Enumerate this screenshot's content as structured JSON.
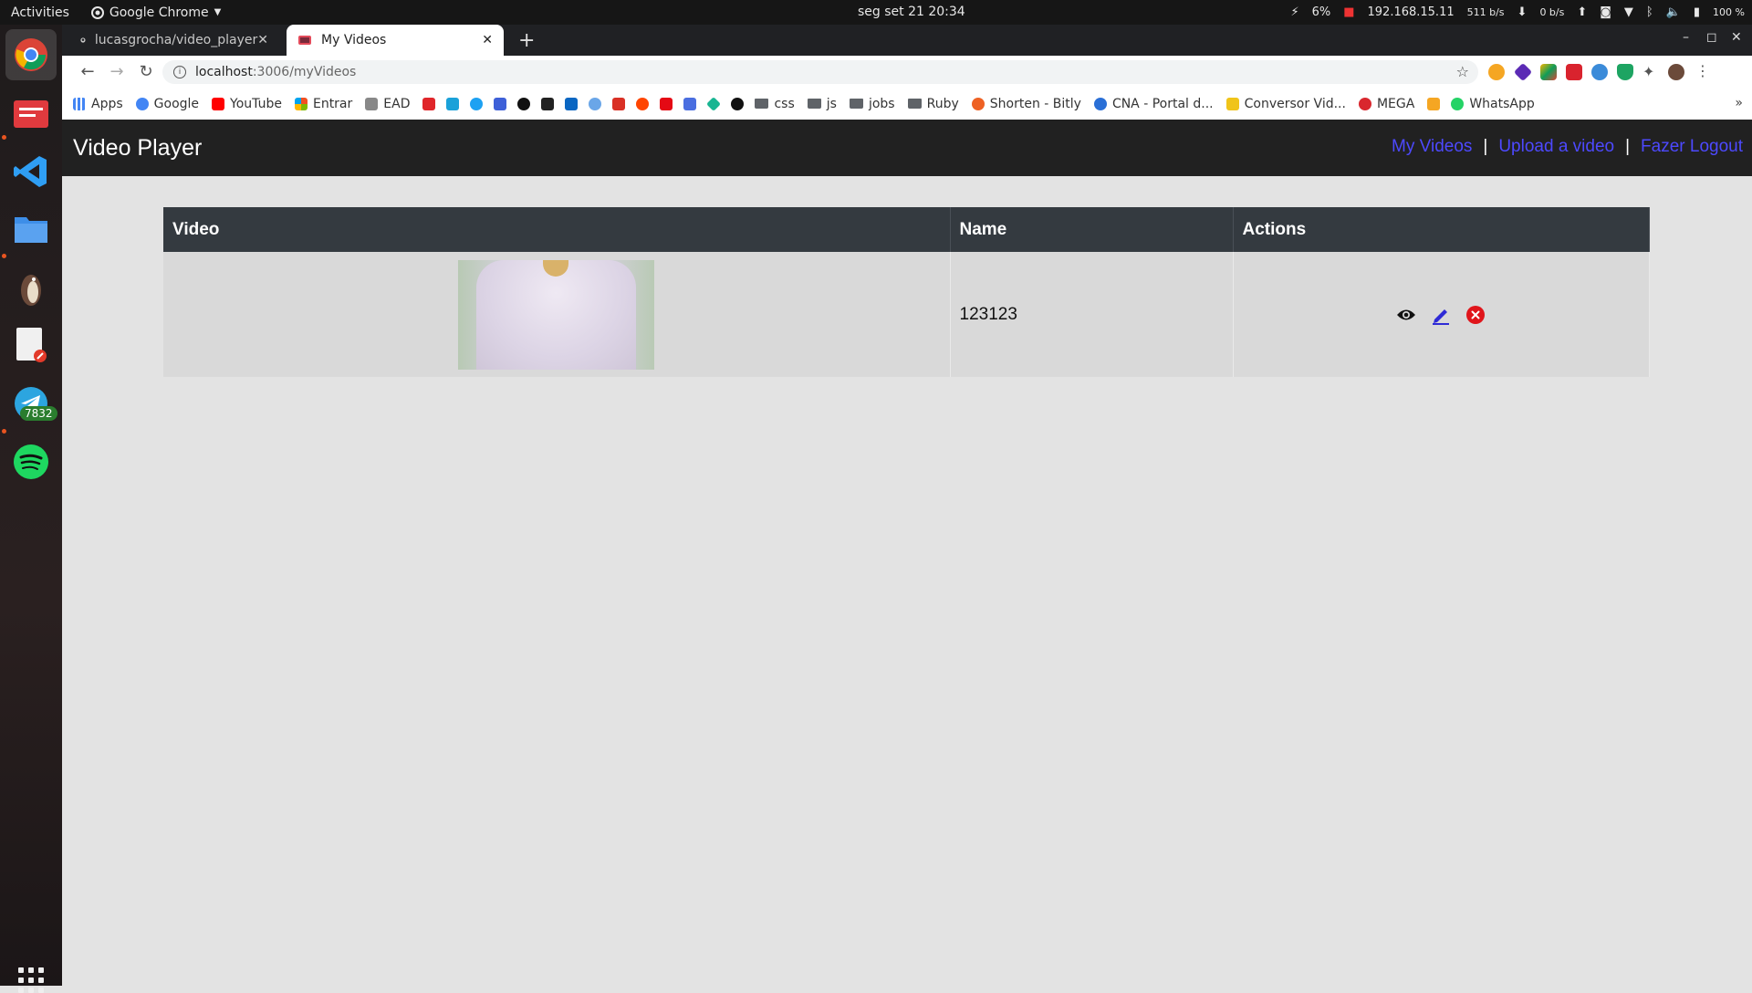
{
  "topbar": {
    "activities": "Activities",
    "app_name": "Google Chrome",
    "clock": "seg set 21  20:34",
    "cpu": "6%",
    "ip": "192.168.15.11",
    "down_speed": "511 b/s",
    "up_speed": "0 b/s",
    "battery": "100 %"
  },
  "dock": {
    "telegram_badge": "7832"
  },
  "browser": {
    "tabs": [
      {
        "label": "lucasgrocha/video_player"
      },
      {
        "label": "My Videos"
      }
    ],
    "url_host": "localhost",
    "url_path": ":3006/myVideos",
    "bookmarks": [
      "Apps",
      "Google",
      "YouTube",
      "Entrar",
      "EAD",
      "css",
      "js",
      "jobs",
      "Ruby",
      "Shorten - Bitly",
      "CNA - Portal d...",
      "Conversor Vid...",
      "MEGA",
      "WhatsApp"
    ]
  },
  "app": {
    "brand": "Video Player",
    "nav": {
      "my_videos": "My Videos",
      "upload": "Upload a video",
      "logout": "Fazer Logout",
      "separator": "|"
    },
    "table": {
      "headers": {
        "video": "Video",
        "name": "Name",
        "actions": "Actions"
      },
      "rows": [
        {
          "name": "123123"
        }
      ]
    }
  },
  "colors": {
    "nav_link": "#4d49ff",
    "navbar_bg": "#212121",
    "table_header_bg": "#343a40",
    "delete_red": "#e0151b",
    "edit_blue": "#2f2bd6"
  }
}
